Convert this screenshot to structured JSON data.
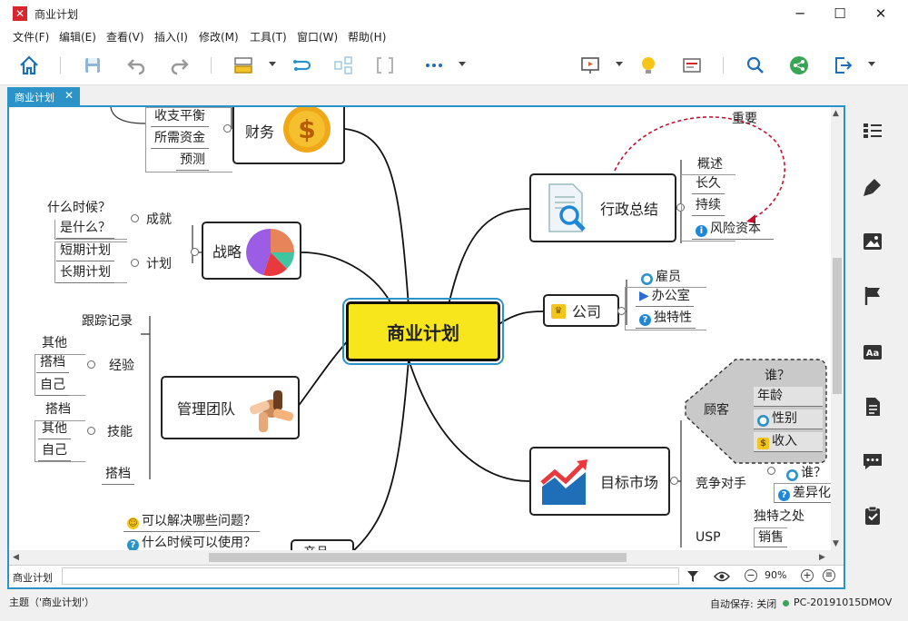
{
  "window": {
    "title": "商业计划",
    "minimize": "─",
    "maximize": "☐",
    "close": "✕"
  },
  "menu": [
    "文件(F)",
    "编辑(E)",
    "查看(V)",
    "插入(I)",
    "修改(M)",
    "工具(T)",
    "窗口(W)",
    "帮助(H)"
  ],
  "tab": {
    "label": "商业计划",
    "close": "✕"
  },
  "mindmap": {
    "central": "商业计划",
    "finance": {
      "label": "财务",
      "children": [
        "收支平衡",
        "所需资金",
        "预测"
      ]
    },
    "strategy": {
      "label": "战略",
      "achievement": {
        "label": "成就",
        "children": [
          "什么时候？",
          "是什么？"
        ]
      },
      "plan": {
        "label": "计划",
        "children": [
          "短期计划",
          "长期计划"
        ]
      }
    },
    "team": {
      "label": "管理团队",
      "tracking": "跟踪记录",
      "experience": {
        "label": "经验",
        "children": [
          "其他",
          "搭档",
          "自己"
        ]
      },
      "skills": {
        "label": "技能",
        "children": [
          "搭档",
          "其他",
          "自己"
        ]
      },
      "partner": "搭档"
    },
    "product": {
      "label": "产品",
      "children": [
        "可以解决哪些问题？",
        "什么时候可以使用？"
      ]
    },
    "executive": {
      "label": "行政总结",
      "children": [
        "概述",
        "长久",
        "持续",
        "风险资本"
      ],
      "relationship": "重要"
    },
    "company": {
      "label": "公司",
      "children": [
        "雇员",
        "办公室",
        "独特性"
      ]
    },
    "market": {
      "label": "目标市场",
      "customer": {
        "label": "顾客",
        "children": [
          "谁？",
          "年龄",
          "性别",
          "收入"
        ]
      },
      "competitor": {
        "label": "竞争对手",
        "children": [
          "谁？",
          "差异化"
        ]
      },
      "usp": {
        "label": "USP",
        "children": [
          "独特之处",
          "销售"
        ]
      }
    }
  },
  "filter_bar": {
    "label": "商业计划",
    "zoom": "90%",
    "minus": "−",
    "plus": "+"
  },
  "status": {
    "topic": "主题（'商业计划'）",
    "autosave": "自动保存: 关闭",
    "computer": "PC-20191015DMOV"
  },
  "colors": {
    "accent": "#2c93c9",
    "central_fill": "#f7e61c",
    "relationship": "#c8102e"
  }
}
